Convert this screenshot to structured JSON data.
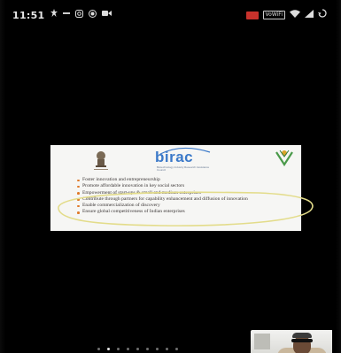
{
  "status_bar": {
    "time": "11:51",
    "left_icons": [
      "notification-icon",
      "minus-icon",
      "instagram-icon",
      "record-icon",
      "video-icon"
    ],
    "right_icons": [
      "red-app-icon",
      "volte-icon",
      "wifi-icon",
      "signal-icon",
      "sync-icon"
    ],
    "volte_label": "VoWiFi"
  },
  "slide": {
    "logo_text": "birac",
    "logo_subtitle": "Biotechnology Industry Research Assistance Council",
    "emblem_caption": "Government of India",
    "bullets": [
      "Foster innovation and entrepreneurship",
      "Promote affordable innovation in key social sectors",
      "Empowerment of start-ups & small and medium enterprises",
      "Contribute through partners for capability enhancement and diffusion of innovation",
      "Enable commercialization of discovery",
      "Ensure global competitiveness of Indian enterprises"
    ],
    "colors": {
      "logo_blue": "#3b79c9",
      "bullet_orange": "#e07a2a",
      "highlight_yellow": "#e3dc8a"
    }
  },
  "pager": {
    "total_pages": 9,
    "current_page": 2
  },
  "self_video": {
    "label": "self-view"
  }
}
